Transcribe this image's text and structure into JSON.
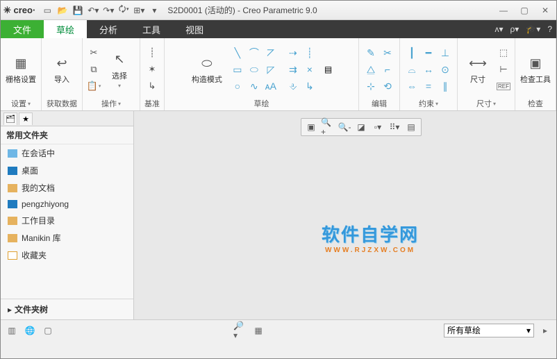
{
  "app": {
    "brand": "creo",
    "title": "S2D0001 (活动的) - Creo Parametric 9.0"
  },
  "tabs": {
    "file": "文件",
    "items": [
      "草绘",
      "分析",
      "工具",
      "视图"
    ],
    "active": 0
  },
  "ribbon": {
    "groups": [
      {
        "label": "设置",
        "hasDD": true,
        "items": [
          {
            "text": "栅格设置"
          }
        ]
      },
      {
        "label": "获取数据",
        "items": [
          {
            "text": "导入"
          }
        ]
      },
      {
        "label": "操作",
        "hasDD": true,
        "items": [
          {
            "text": "选择"
          }
        ]
      },
      {
        "label": "基准"
      },
      {
        "label": "草绘",
        "items": [
          {
            "text": "构造模式"
          }
        ]
      },
      {
        "label": "编辑"
      },
      {
        "label": "约束",
        "hasDD": true
      },
      {
        "label": "尺寸",
        "hasDD": true,
        "items": [
          {
            "text": "尺寸"
          }
        ]
      },
      {
        "label": "检查",
        "items": [
          {
            "text": "检查工具"
          }
        ]
      }
    ]
  },
  "sidebar": {
    "header": "常用文件夹",
    "items": [
      {
        "label": "在会话中",
        "color": "#6fb7e6"
      },
      {
        "label": "桌面",
        "color": "#1f7bbf"
      },
      {
        "label": "我的文档",
        "color": "#e6b25e"
      },
      {
        "label": "pengzhiyong",
        "color": "#1f7bbf"
      },
      {
        "label": "工作目录",
        "color": "#e6b25e"
      },
      {
        "label": "Manikin 库",
        "color": "#e6b25e"
      },
      {
        "label": "收藏夹",
        "color": "#e0a030"
      }
    ],
    "footer": "文件夹树"
  },
  "watermark": {
    "main": "软件自学网",
    "sub": "WWW.RJZXW.COM"
  },
  "status": {
    "filter": "所有草绘"
  }
}
